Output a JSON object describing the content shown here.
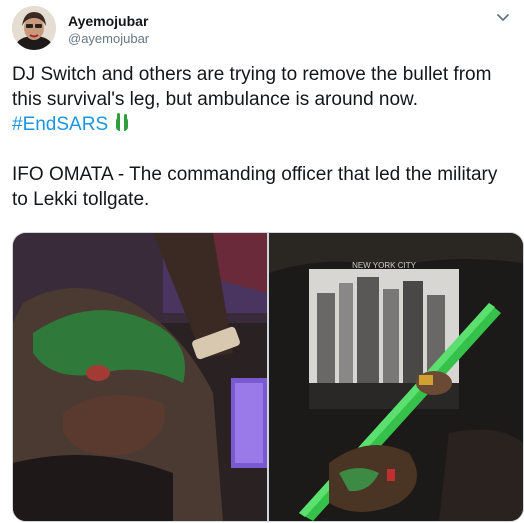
{
  "tweet": {
    "display_name": "Ayemojubar",
    "handle": "@ayemojubar",
    "text_part1": "DJ Switch and others are trying to remove the bullet from this survival's leg, but ambulance is around now.",
    "hashtag": "#EndSARS",
    "hashtag_emoji_icon": "nigeria-flag-hand-emoji",
    "text_part2": "IFO OMATA - The commanding officer that led the military to Lekki tollgate."
  },
  "media": {
    "count": 2,
    "shirt_print": "NEW YORK CITY"
  },
  "colors": {
    "link": "#1b95e0",
    "text": "#14171a",
    "secondary": "#657786",
    "green": "#2e9e3e"
  }
}
